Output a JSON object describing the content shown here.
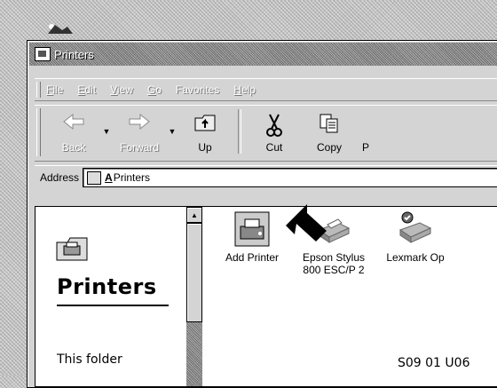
{
  "window": {
    "title": "Printers"
  },
  "menu": [
    {
      "label": "File",
      "u": "F",
      "rest": "ile"
    },
    {
      "label": "Edit",
      "u": "E",
      "rest": "dit"
    },
    {
      "label": "View",
      "u": "V",
      "rest": "iew"
    },
    {
      "label": "Go",
      "u": "G",
      "rest": "o"
    },
    {
      "label": "Favorites",
      "u": "",
      "rest": "Favorites"
    },
    {
      "label": "Help",
      "u": "H",
      "rest": "elp"
    }
  ],
  "toolbar": {
    "back": {
      "label": "Back",
      "icon": "back-arrow-icon",
      "enabled": false
    },
    "forward": {
      "label": "Forward",
      "icon": "forward-arrow-icon",
      "enabled": false
    },
    "up": {
      "label": "Up",
      "icon": "up-folder-icon",
      "enabled": true
    },
    "cut": {
      "label": "Cut",
      "icon": "scissors-icon",
      "enabled": true
    },
    "copy": {
      "label": "Copy",
      "icon": "copy-icon",
      "enabled": true
    },
    "paste_partial": "P"
  },
  "address": {
    "label": "Address",
    "value": "Printers"
  },
  "left_pane": {
    "heading": "Printers",
    "description_partial": "This folder"
  },
  "printers": [
    {
      "name_line1": "Add Printer",
      "name_line2": "",
      "icon": "add-printer-icon"
    },
    {
      "name_line1": "Epson Stylus",
      "name_line2": "800 ESC/P 2",
      "icon": "printer-icon"
    },
    {
      "name_line1": "Lexmark Op",
      "name_line2": "",
      "icon": "printer-default-icon"
    }
  ],
  "figure_caption": "S09 01 U06"
}
